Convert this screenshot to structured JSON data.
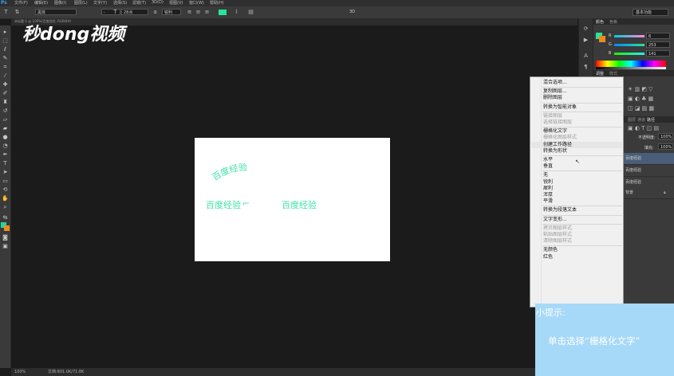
{
  "menubar": {
    "logo": "Ps",
    "items": [
      "文件(F)",
      "编辑(E)",
      "图像(I)",
      "图层(L)",
      "文字(Y)",
      "选择(S)",
      "滤镜(T)",
      "3D(D)",
      "视图(V)",
      "窗口(W)",
      "帮助(H)"
    ]
  },
  "options": {
    "tool_glyph": "T",
    "font_family": "黑体",
    "font_size": "28点",
    "antialias": "锐利",
    "mode_3d": "3D",
    "workspace": "基本功能"
  },
  "doc_tab": {
    "label": "未标题-1 @ 100%(百度经验, RGB/8#)"
  },
  "watermark": "秒dong视频",
  "canvas": {
    "texts": [
      "百度经验",
      "百度经验",
      "百度经验"
    ]
  },
  "statusbar": {
    "zoom": "100%",
    "info": "文档:801.0K/71.8K"
  },
  "panels": {
    "color_tabs": [
      "颜色",
      "色板"
    ],
    "rgb": {
      "r": "6",
      "g": "253",
      "b": "141"
    },
    "adjust_tabs": [
      "调整",
      "样式"
    ],
    "layers_tabs": [
      "图层",
      "通道",
      "路径"
    ],
    "opacity_label": "不透明度:",
    "opacity_value": "100%",
    "fill_label": "填充:",
    "fill_value": "100%",
    "layers": [
      "百度经验",
      "百度经验",
      "百度经验",
      "背景"
    ]
  },
  "context_menu": {
    "items": [
      {
        "label": "混合选项...",
        "disabled": false
      },
      {
        "sep": true
      },
      {
        "label": "复制图层...",
        "disabled": false
      },
      {
        "label": "删除图层",
        "disabled": false
      },
      {
        "sep": true
      },
      {
        "label": "转换为智能对象",
        "disabled": false
      },
      {
        "sep": true
      },
      {
        "label": "链接图层",
        "disabled": true
      },
      {
        "label": "选择链接图层",
        "disabled": true
      },
      {
        "sep": true
      },
      {
        "label": "栅格化文字",
        "disabled": false
      },
      {
        "label": "栅格化图层样式",
        "disabled": true
      },
      {
        "label": "创建工作路径",
        "disabled": false,
        "hover": true
      },
      {
        "label": "转换为形状",
        "disabled": false
      },
      {
        "sep": true
      },
      {
        "label": "水平",
        "disabled": false
      },
      {
        "label": "垂直",
        "disabled": false
      },
      {
        "sep": true
      },
      {
        "label": "无",
        "disabled": false
      },
      {
        "label": "锐利",
        "disabled": false
      },
      {
        "label": "犀利",
        "disabled": false
      },
      {
        "label": "浑厚",
        "disabled": false
      },
      {
        "label": "平滑",
        "disabled": false
      },
      {
        "sep": true
      },
      {
        "label": "转换为段落文本",
        "disabled": false
      },
      {
        "sep": true
      },
      {
        "label": "文字变形...",
        "disabled": false
      },
      {
        "sep": true
      },
      {
        "label": "拷贝图层样式",
        "disabled": true
      },
      {
        "label": "粘贴图层样式",
        "disabled": true
      },
      {
        "label": "清除图层样式",
        "disabled": true
      },
      {
        "sep": true
      },
      {
        "label": "无颜色",
        "disabled": false
      },
      {
        "label": "红色",
        "disabled": false
      }
    ]
  },
  "tip": {
    "title": "小提示:",
    "body": "单击选择“栅格化文字”"
  },
  "colors": {
    "accent_green": "#2ae39a",
    "canvas_text": "#3ee2a6",
    "tip_bg": "#a6d8f8",
    "bg_orange": "#ee8b1e"
  }
}
